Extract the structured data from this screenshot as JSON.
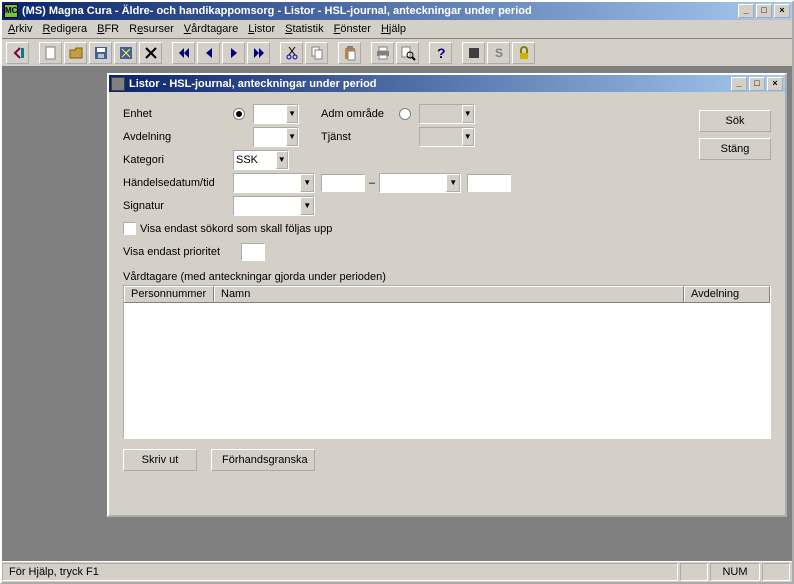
{
  "main_window": {
    "title": "(MS) Magna Cura - Äldre- och handikappomsorg - Listor - HSL-journal, anteckningar under period",
    "appicon_text": "MC"
  },
  "menu": {
    "arkiv": "Arkiv",
    "redigera": "Redigera",
    "bfr": "BFR",
    "resurser": "Resurser",
    "vardtagare": "Vårdtagare",
    "listor": "Listor",
    "statistik": "Statistik",
    "fonster": "Fönster",
    "hjalp": "Hjälp"
  },
  "toolbar_icons": {
    "back_root": "back-root-icon",
    "new": "new-icon",
    "open": "open-icon",
    "save": "save-icon",
    "cut_ext": "cut-ext-icon",
    "delete": "delete-icon",
    "first": "first-icon",
    "prev": "prev-icon",
    "next": "next-icon",
    "last": "last-icon",
    "cut": "cut-icon",
    "copy": "copy-icon",
    "paste": "paste-icon",
    "print": "print-icon",
    "print_preview": "print-preview-icon",
    "help": "help-icon",
    "stop": "stop-icon",
    "s_button": "s-button-icon",
    "lock": "lock-icon"
  },
  "dialog": {
    "title": "Listor - HSL-journal, anteckningar under period",
    "labels": {
      "enhet": "Enhet",
      "avdelning": "Avdelning",
      "kategori": "Kategori",
      "handelsedatum": "Händelsedatum/tid",
      "signatur": "Signatur",
      "adm_omrade": "Adm område",
      "tjanst": "Tjänst",
      "visa_endast_sokord": "Visa endast sökord som skall följas upp",
      "visa_endast_prioritet": "Visa endast prioritet",
      "section_title": "Vårdtagare (med anteckningar gjorda under perioden)",
      "date_separator": "–"
    },
    "values": {
      "enhet": "",
      "avdelning": "",
      "kategori": "SSK",
      "date_from": "",
      "time_from": "",
      "date_to": "",
      "time_to": "",
      "signatur": "",
      "adm_omrade": "",
      "tjanst": "",
      "prioritet": "",
      "enhet_radio_checked": true,
      "adm_radio_checked": false,
      "visa_sokord_checked": false
    },
    "columns": {
      "personnummer": "Personnummer",
      "namn": "Namn",
      "avdelning": "Avdelning"
    },
    "buttons": {
      "sok": "Sök",
      "stang": "Stäng",
      "skriv_ut": "Skriv ut",
      "forhandsgranska": "Förhandsgranska"
    }
  },
  "statusbar": {
    "help_text": "För Hjälp, tryck F1",
    "num": "NUM"
  },
  "win_controls": {
    "min": "_",
    "max": "□",
    "close": "×"
  }
}
